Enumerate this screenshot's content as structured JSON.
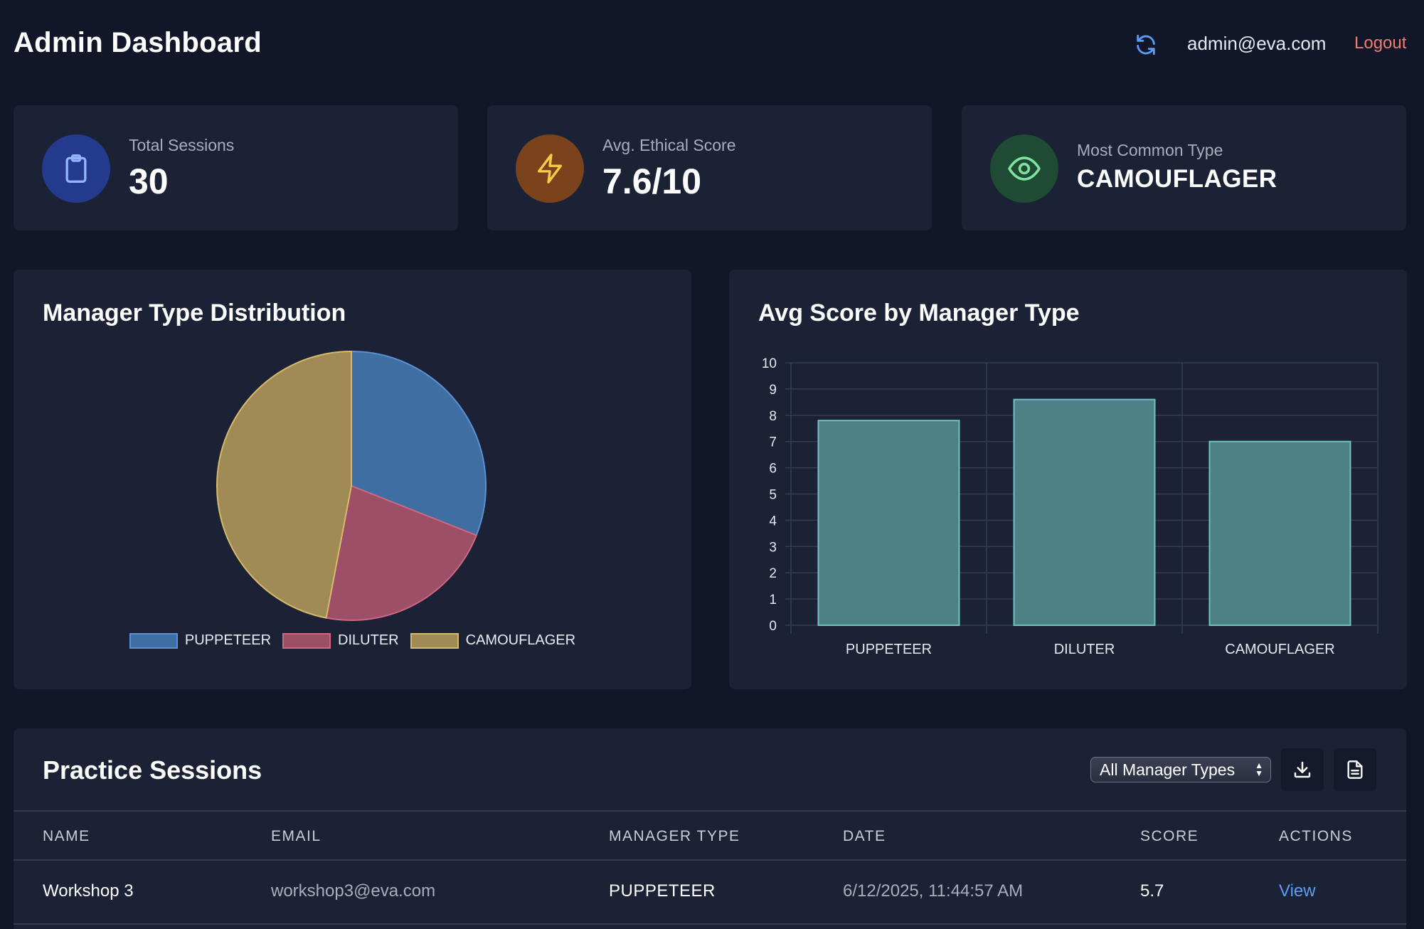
{
  "header": {
    "title": "Admin Dashboard",
    "user_email": "admin@eva.com",
    "logout_label": "Logout",
    "refresh_icon": "refresh-icon"
  },
  "stats": [
    {
      "label": "Total Sessions",
      "value": "30",
      "icon": "clipboard-icon",
      "icon_bg": "#243a8c",
      "icon_color": "#93b4ff"
    },
    {
      "label": "Avg. Ethical Score",
      "value": "7.6/10",
      "icon": "lightning-icon",
      "icon_bg": "#7a431c",
      "icon_color": "#f7c948"
    },
    {
      "label": "Most Common Type",
      "value": "CAMOUFLAGER",
      "icon": "eye-icon",
      "icon_bg": "#1f4a33",
      "icon_color": "#7ee2a0"
    }
  ],
  "pie_chart": {
    "title": "Manager Type Distribution",
    "chart_data": {
      "type": "pie",
      "categories": [
        "PUPPETEER",
        "DILUTER",
        "CAMOUFLAGER"
      ],
      "values": [
        31,
        22,
        47
      ],
      "colors": [
        "#3f6ea3",
        "#9c4f67",
        "#a08a55"
      ],
      "borders": [
        "#5a90d6",
        "#d06680",
        "#d8b96a"
      ],
      "legend": "bottom"
    }
  },
  "bar_chart": {
    "title": "Avg Score by Manager Type",
    "chart_data": {
      "type": "bar",
      "categories": [
        "PUPPETEER",
        "DILUTER",
        "CAMOUFLAGER"
      ],
      "values": [
        7.8,
        8.6,
        7.0
      ],
      "ylim": [
        0,
        10
      ],
      "yticks": [
        "0",
        "1",
        "2",
        "3",
        "4",
        "5",
        "6",
        "7",
        "8",
        "9",
        "10"
      ],
      "grid": true,
      "bar_color": "#4e8185",
      "bar_border": "#6cc2c2"
    }
  },
  "table": {
    "title": "Practice Sessions",
    "filter": {
      "selected": "All Manager Types"
    },
    "download_icon": "download-icon",
    "report_icon": "document-icon",
    "columns": [
      "NAME",
      "EMAIL",
      "MANAGER TYPE",
      "DATE",
      "SCORE",
      "ACTIONS"
    ],
    "rows": [
      {
        "name": "Workshop 3",
        "email": "workshop3@eva.com",
        "manager_type": "PUPPETEER",
        "date": "6/12/2025, 11:44:57 AM",
        "score": "5.7",
        "action": "View"
      }
    ]
  }
}
